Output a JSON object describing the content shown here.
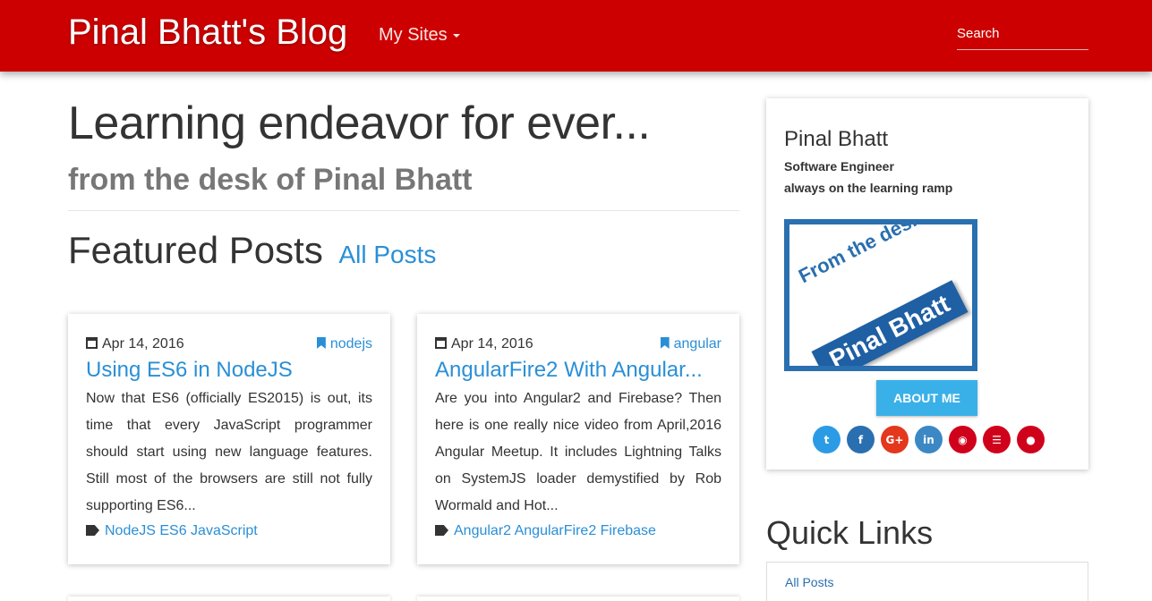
{
  "navbar": {
    "brand": "Pinal Bhatt's Blog",
    "my_sites": "My Sites",
    "search_placeholder": "Search",
    "bg_color": "#cc0000"
  },
  "header": {
    "title": "Learning endeavor for ever...",
    "subtitle": "from the desk of Pinal Bhatt"
  },
  "featured": {
    "heading": "Featured Posts",
    "all_posts": "All Posts"
  },
  "posts": [
    {
      "date": "Apr 14, 2016",
      "tag": "nodejs",
      "title": "Using ES6 in NodeJS",
      "excerpt": "Now that ES6 (officially ES2015) is out, its time that every JavaScript programmer should start using new language features. Still most of the browsers are still not fully supporting ES6...",
      "tags": "NodeJS ES6 JavaScript"
    },
    {
      "date": "Apr 14, 2016",
      "tag": "angular",
      "title": "AngularFire2 With Angular...",
      "excerpt": "Are you into Angular2 and Firebase? Then here is one really nice video from April,2016 Angular Meetup. It includes Lightning Talks on SystemJS loader demystified by Rob Wormald and Hot...",
      "tags": "Angular2 AngularFire2 Firebase"
    }
  ],
  "profile": {
    "name": "Pinal Bhatt",
    "role": "Software Engineer",
    "tagline": "always on the learning ramp",
    "logo_line1": "From the desk of",
    "logo_line2": "Pinal Bhatt",
    "about_button": "ABOUT ME",
    "social": [
      {
        "icon": "twitter-icon",
        "glyph": "t",
        "color": "#2b9be6"
      },
      {
        "icon": "facebook-icon",
        "glyph": "f",
        "color": "#2a6fb0"
      },
      {
        "icon": "google-plus-icon",
        "glyph": "G+",
        "color": "#e3371e"
      },
      {
        "icon": "linkedin-icon",
        "glyph": "in",
        "color": "#3b88c4"
      },
      {
        "icon": "github-icon",
        "glyph": "◉",
        "color": "#d0021b"
      },
      {
        "icon": "rss-icon",
        "glyph": "☰",
        "color": "#d0021b"
      },
      {
        "icon": "user-icon",
        "glyph": "●",
        "color": "#d0021b"
      }
    ]
  },
  "quick_links": {
    "heading": "Quick Links",
    "items": [
      "All Posts"
    ]
  }
}
